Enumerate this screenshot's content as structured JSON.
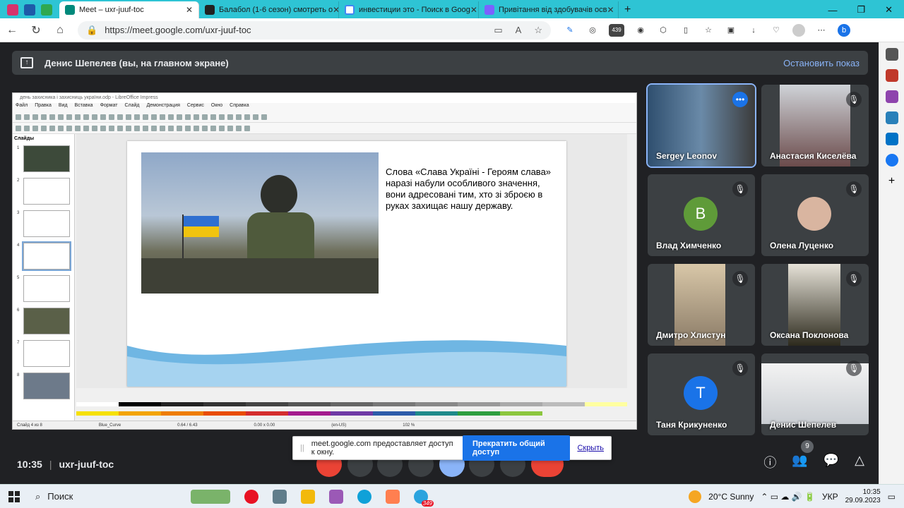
{
  "browser": {
    "tabs": [
      {
        "title": "Meet – uxr-juuf-toc",
        "active": true
      },
      {
        "title": "Балабол (1-6 сезон) смотреть о",
        "active": false
      },
      {
        "title": "инвестиции это - Поиск в Goog",
        "active": false
      },
      {
        "title": "Привітання від здобувачів осв",
        "active": false
      }
    ],
    "url": "https://meet.google.com/uxr-juuf-toc",
    "ext_badge": "439"
  },
  "presenting": {
    "banner_text": "Денис Шепелев (вы, на главном экране)",
    "stop_label": "Остановить показ"
  },
  "impress": {
    "title": "день захисника і захисниць україни.odp - LibreOffice Impress",
    "menu": [
      "Файл",
      "Правка",
      "Вид",
      "Вставка",
      "Формат",
      "Слайд",
      "Демонстрация",
      "Сервис",
      "Окно",
      "Справка"
    ],
    "slides_header": "Слайды",
    "slide_numbers": [
      "1",
      "2",
      "3",
      "4",
      "5",
      "6",
      "7",
      "8"
    ],
    "slide_text": "Слова «Слава Україні  - Героям слава» наразі набули особливого значення, вони адресовані тим, хто зі зброєю в руках захищає нашу державу.",
    "status": {
      "slide": "Слайд 4 из 8",
      "style": "Blue_Curve",
      "pos": "0.64 / 6.43",
      "size": "0.00 x 0.00",
      "lang": "(en-US)",
      "zoom": "102 %"
    }
  },
  "participants": [
    {
      "name": "Sergey Leonov",
      "avatar": "",
      "color": "",
      "video": true
    },
    {
      "name": "Анастасия Киселёва",
      "avatar": "",
      "color": "",
      "video": true
    },
    {
      "name": "Влад Химченко",
      "avatar": "В",
      "color": "#5f9b39",
      "video": false
    },
    {
      "name": "Олена Луценко",
      "avatar": "",
      "color": "",
      "video": false
    },
    {
      "name": "Дмитро Хлистун",
      "avatar": "",
      "color": "",
      "video": true
    },
    {
      "name": "Оксана Поклонова",
      "avatar": "",
      "color": "",
      "video": true
    },
    {
      "name": "Таня Крикуненко",
      "avatar": "T",
      "color": "#1a73e8",
      "video": false
    },
    {
      "name": "Денис Шепелев",
      "avatar": "",
      "color": "",
      "video": true
    }
  ],
  "meeting": {
    "time": "10:35",
    "code": "uxr-juuf-toc",
    "people_count": "9"
  },
  "share_bar": {
    "text": "meet.google.com предоставляет доступ к окну.",
    "stop": "Прекратить общий доступ",
    "hide": "Скрыть"
  },
  "taskbar": {
    "search": "Поиск",
    "weather": "20°C  Sunny",
    "lang": "УКР",
    "time": "10:35",
    "date": "29.09.2023",
    "telegram_badge": "349"
  }
}
